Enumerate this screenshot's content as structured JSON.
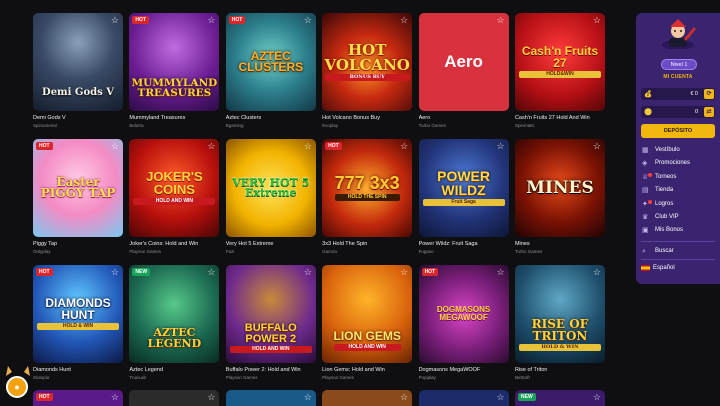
{
  "games": [
    {
      "name": "Demi Gods V",
      "provider": "Spinomenal",
      "badge": "",
      "art": "Demi Gods V",
      "sub": ""
    },
    {
      "name": "Mummyland Treasures",
      "provider": "Belatra",
      "badge": "HOT",
      "art": "MUMMYLAND TREASURES",
      "sub": ""
    },
    {
      "name": "Aztec Clusters",
      "provider": "Bgaming",
      "badge": "HOT",
      "art": "AZTEC CLUSTERS",
      "sub": ""
    },
    {
      "name": "Hot Volcano Bonus Buy",
      "provider": "Evoplay",
      "badge": "",
      "art": "HOT VOLCANO",
      "sub": "BONUS BUY"
    },
    {
      "name": "Aero",
      "provider": "Turbo Games",
      "badge": "",
      "art": "Aero",
      "sub": ""
    },
    {
      "name": "Cash'n Fruits 27 Hold And Win",
      "provider": "Spinmatic",
      "badge": "",
      "art": "Cash'n Fruits 27",
      "sub": "HOLD&WIN"
    },
    {
      "name": "Piggy Tap",
      "provider": "Onlyplay",
      "badge": "HOT",
      "art": "Easter PIGGY TAP",
      "sub": ""
    },
    {
      "name": "Joker's Coins: Hold and Win",
      "provider": "Playson Games",
      "badge": "",
      "art": "JOKER'S COINS",
      "sub": "HOLD AND WIN"
    },
    {
      "name": "Very Hot 5 Extreme",
      "provider": "Fazi",
      "badge": "",
      "art": "VERY HOT 5 Extreme",
      "sub": ""
    },
    {
      "name": "3x3 Hold The Spin",
      "provider": "Gamzix",
      "badge": "HOT",
      "art": "777 3x3",
      "sub": "HOLD THE SPIN"
    },
    {
      "name": "Power Wildz: Fruit Saga",
      "provider": "Fugaso",
      "badge": "",
      "art": "POWER WILDZ",
      "sub": "Fruit Saga"
    },
    {
      "name": "Mines",
      "provider": "Turbo Games",
      "badge": "",
      "art": "MINES",
      "sub": ""
    },
    {
      "name": "Diamonds Hunt",
      "provider": "Slotopia",
      "badge": "HOT",
      "art": "DIAMONDS HUNT",
      "sub": "HOLD & WIN"
    },
    {
      "name": "Aztec Legend",
      "provider": "TrueLab",
      "badge": "NEW",
      "art": "AZTEC LEGEND",
      "sub": ""
    },
    {
      "name": "Buffalo Power 2: Hold and Win",
      "provider": "Playson Games",
      "badge": "",
      "art": "BUFFALO POWER 2",
      "sub": "HOLD AND WIN"
    },
    {
      "name": "Lion Gems: Hold and Win",
      "provider": "Playson Games",
      "badge": "",
      "art": "LION GEMS",
      "sub": "HOLD AND WIN"
    },
    {
      "name": "Dogmasons MegaWOOF",
      "provider": "Popiplay",
      "badge": "HOT",
      "art": "DOGMASONS MEGAWOOF",
      "sub": ""
    },
    {
      "name": "Rise of Triton",
      "provider": "BetSoft",
      "badge": "",
      "art": "RISE OF TRITON",
      "sub": "HOLD & WIN"
    }
  ],
  "next_row_badges": [
    "HOT",
    "",
    "",
    "",
    "",
    "NEW"
  ],
  "panel": {
    "level": "Nivel 1",
    "account_link": "MI CUENTA",
    "balance_money": "€ 0",
    "balance_coins": "0",
    "deposit": "DEPÓSITO",
    "menu": [
      {
        "label": "Vestíbulo",
        "icon": "lobby-icon"
      },
      {
        "label": "Promociones",
        "icon": "promo-icon"
      },
      {
        "label": "Torneos",
        "icon": "trophy-icon"
      },
      {
        "label": "Tienda",
        "icon": "shop-icon"
      },
      {
        "label": "Logros",
        "icon": "achievement-icon"
      },
      {
        "label": "Club VIP",
        "icon": "vip-icon"
      },
      {
        "label": "Mis Bonos",
        "icon": "bonus-icon"
      }
    ],
    "search": "Buscar",
    "language": "Español"
  }
}
